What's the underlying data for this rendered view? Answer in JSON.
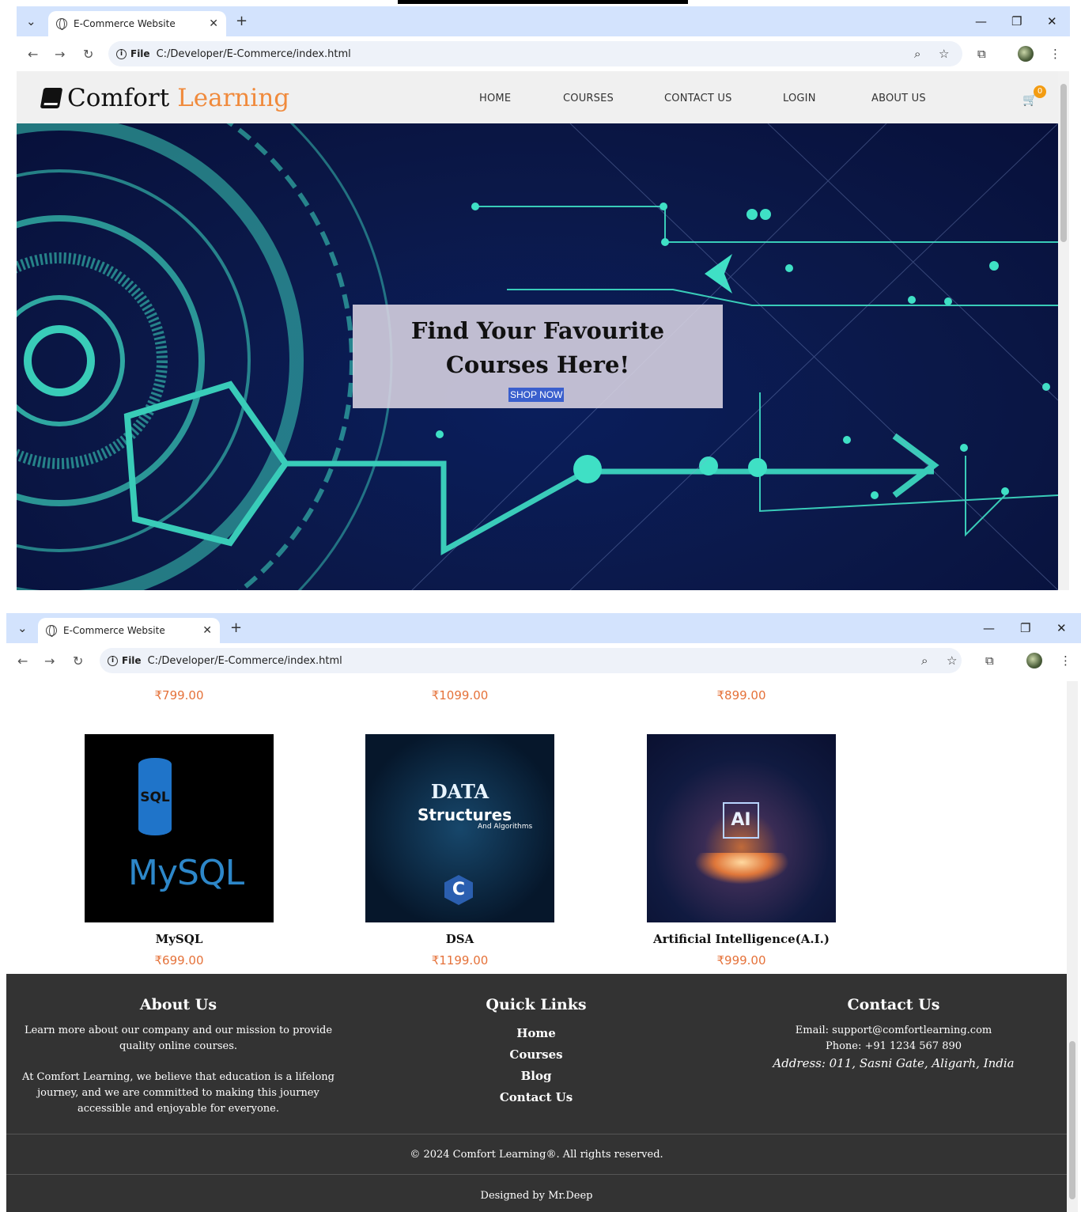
{
  "browser": {
    "tab_title": "E-Commerce Website",
    "scheme_label": "File",
    "url": "C:/Developer/E-Commerce/index.html"
  },
  "site": {
    "logo_part1": "Comfort",
    "logo_part2": "Learning",
    "nav": [
      "HOME",
      "COURSES",
      "CONTACT US",
      "LOGIN",
      "ABOUT US"
    ],
    "cart_count": "0"
  },
  "hero": {
    "title_line1": "Find Your Favourite",
    "title_line2": "Courses Here!",
    "cta": "SHOP NOW"
  },
  "previous_row_prices": [
    "₹799.00",
    "₹1099.00",
    "₹899.00"
  ],
  "courses": [
    {
      "name": "MySQL",
      "price": "₹699.00",
      "image_text": "MySQL",
      "image_badge": "SQL"
    },
    {
      "name": "DSA",
      "price": "₹1199.00",
      "image_text_1": "DATA",
      "image_text_2": "Structures",
      "image_text_3": "And Algorithms",
      "image_badge": "C"
    },
    {
      "name": "Artificial Intelligence(A.I.)",
      "price": "₹999.00",
      "image_badge": "AI"
    }
  ],
  "footer": {
    "about": {
      "title": "About Us",
      "p1": "Learn more about our company and our mission to provide quality online courses.",
      "p2": "At Comfort Learning, we believe that education is a lifelong journey, and we are committed to making this journey accessible and enjoyable for everyone."
    },
    "links": {
      "title": "Quick Links",
      "items": [
        "Home",
        "Courses",
        "Blog",
        "Contact Us"
      ]
    },
    "contact": {
      "title": "Contact Us",
      "email": "Email: support@comfortlearning.com",
      "phone": "Phone: +91 1234 567 890",
      "address": "Address: 011, Sasni Gate, Aligarh, India"
    },
    "copyright": "© 2024 Comfort Learning®. All rights reserved.",
    "designed": "Designed by Mr.Deep"
  },
  "colors": {
    "accent": "#f08a3c",
    "price": "#e5723a",
    "footer_bg": "#333333",
    "hero_bg": "#0b1848",
    "chrome_tab_bar": "#d3e3fd"
  }
}
